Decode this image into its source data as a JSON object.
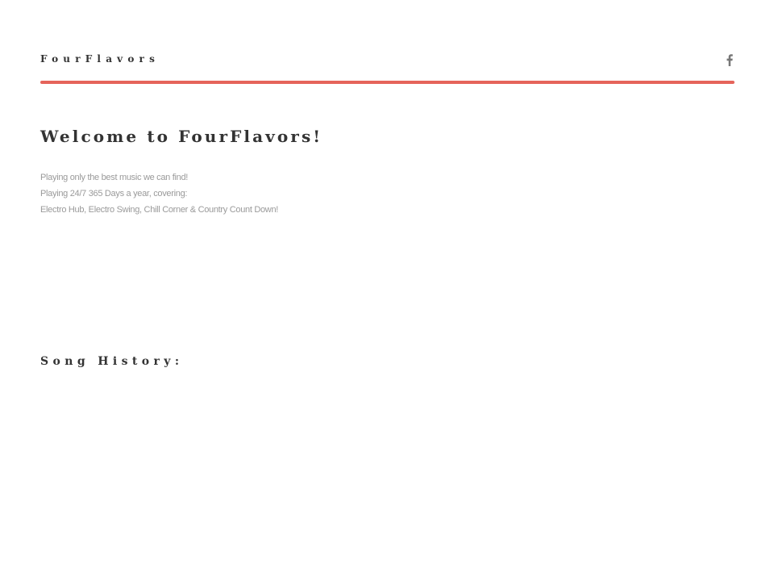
{
  "header": {
    "site_title": "FourFlavors",
    "social_icon": "facebook-icon",
    "accent_color": "#e5645b"
  },
  "main": {
    "welcome_heading": "Welcome to FourFlavors!",
    "intro_lines": [
      "Playing only the best music we can find!",
      "Playing 24/7 365 Days a year, covering:",
      "Electro Hub, Electro Swing, Chill Corner & Country Count Down!"
    ],
    "song_history_heading": "Song History:"
  },
  "colors": {
    "heading_text": "#333333",
    "body_text": "#9a9a9a",
    "background": "#ffffff"
  }
}
